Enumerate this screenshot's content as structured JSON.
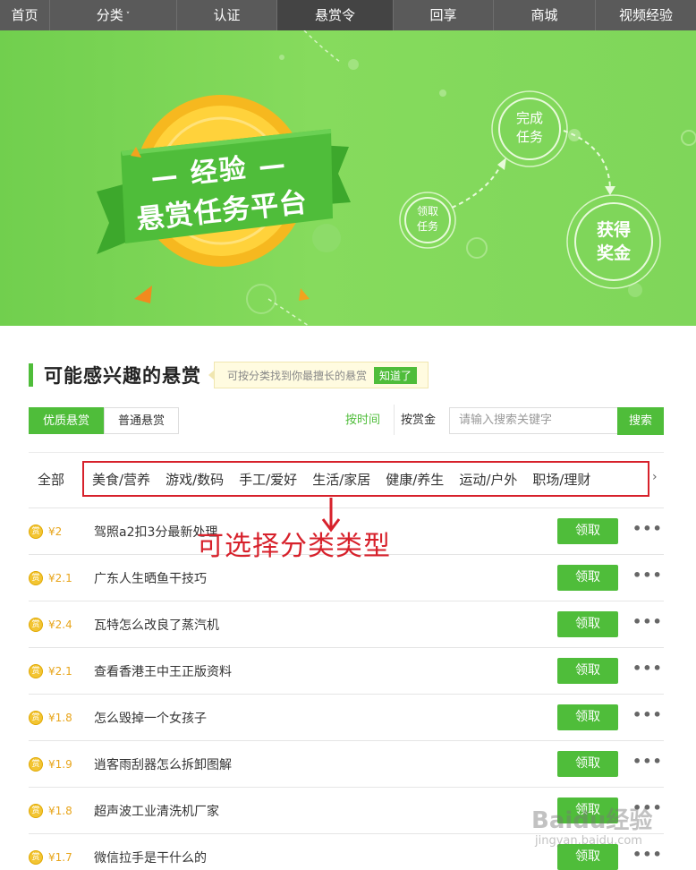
{
  "nav": {
    "items": [
      {
        "label": "首页"
      },
      {
        "label": "分类"
      },
      {
        "label": "认证"
      },
      {
        "label": "悬赏令"
      },
      {
        "label": "回享"
      },
      {
        "label": "商城"
      },
      {
        "label": "视频经验"
      }
    ],
    "caret": "˅"
  },
  "banner": {
    "title_line1": "— 经验 —",
    "title_line2": "悬赏任务平台",
    "step1": [
      "领取",
      "任务"
    ],
    "step2": [
      "完成",
      "任务"
    ],
    "step3": [
      "获得",
      "奖金"
    ]
  },
  "section": {
    "title": "可能感兴趣的悬赏",
    "tip": "可按分类找到你最擅长的悬赏",
    "tip_button": "知道了"
  },
  "tabs": [
    {
      "label": "优质悬赏",
      "active": true
    },
    {
      "label": "普通悬赏",
      "active": false
    }
  ],
  "sort": {
    "by_time": "按时间",
    "by_amount": "按赏金"
  },
  "search": {
    "placeholder": "请输入搜索关键字",
    "button": "搜索"
  },
  "categories": {
    "all": "全部",
    "items": [
      "美食/营养",
      "游戏/数码",
      "手工/爱好",
      "生活/家居",
      "健康/养生",
      "运动/户外",
      "职场/理财"
    ],
    "more_arrow": "›"
  },
  "coin_glyph": "赏",
  "tasks": [
    {
      "amount": "¥2",
      "title": "驾照a2扣3分最新处理",
      "action": "领取"
    },
    {
      "amount": "¥2.1",
      "title": "广东人生晒鱼干技巧",
      "action": "领取"
    },
    {
      "amount": "¥2.4",
      "title": "瓦特怎么改良了蒸汽机",
      "action": "领取"
    },
    {
      "amount": "¥2.1",
      "title": "查看香港王中王正版资料",
      "action": "领取"
    },
    {
      "amount": "¥1.8",
      "title": "怎么毁掉一个女孩子",
      "action": "领取"
    },
    {
      "amount": "¥1.9",
      "title": "逍客雨刮器怎么拆卸图解",
      "action": "领取"
    },
    {
      "amount": "¥1.8",
      "title": "超声波工业清洗机厂家",
      "action": "领取"
    },
    {
      "amount": "¥1.7",
      "title": "微信拉手是干什么的",
      "action": "领取"
    }
  ],
  "more_glyph": "•••",
  "annotation": "可选择分类类型",
  "watermark": {
    "main": "Baidu经验",
    "sub": "jingyan.baidu.com"
  },
  "colors": {
    "accent": "#4fbd3a",
    "annotation": "#d7212b",
    "coin": "#f3c533"
  }
}
